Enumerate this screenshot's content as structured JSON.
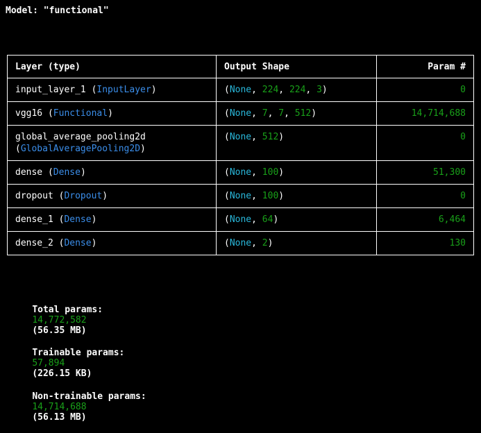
{
  "model_title": "Model: \"functional\"",
  "table": {
    "headers": [
      "Layer (type)",
      "Output Shape",
      "Param #"
    ],
    "rows": [
      {
        "name": "input_layer_1",
        "type": "InputLayer",
        "shape": [
          "None",
          "224",
          "224",
          "3"
        ],
        "params": "0"
      },
      {
        "name": "vgg16",
        "type": "Functional",
        "shape": [
          "None",
          "7",
          "7",
          "512"
        ],
        "params": "14,714,688"
      },
      {
        "name": "global_average_pooling2d",
        "type": "GlobalAveragePooling2D",
        "shape": [
          "None",
          "512"
        ],
        "params": "0",
        "wrap": true
      },
      {
        "name": "dense",
        "type": "Dense",
        "shape": [
          "None",
          "100"
        ],
        "params": "51,300"
      },
      {
        "name": "dropout",
        "type": "Dropout",
        "shape": [
          "None",
          "100"
        ],
        "params": "0"
      },
      {
        "name": "dense_1",
        "type": "Dense",
        "shape": [
          "None",
          "64"
        ],
        "params": "6,464"
      },
      {
        "name": "dense_2",
        "type": "Dense",
        "shape": [
          "None",
          "2"
        ],
        "params": "130"
      }
    ]
  },
  "totals": {
    "total": {
      "label": "Total params:",
      "value": "14,772,582",
      "size": "(56.35 MB)"
    },
    "trainable": {
      "label": "Trainable params:",
      "value": "57,894",
      "size": "(226.15 KB)"
    },
    "non_trainable": {
      "label": "Non-trainable params:",
      "value": "14,714,688",
      "size": "(56.13 MB)"
    }
  },
  "colors": {
    "background": "#000000",
    "text": "#ffffff",
    "class_name": "#3b8eea",
    "none_keyword": "#29b8db",
    "numbers": "#19a019"
  }
}
